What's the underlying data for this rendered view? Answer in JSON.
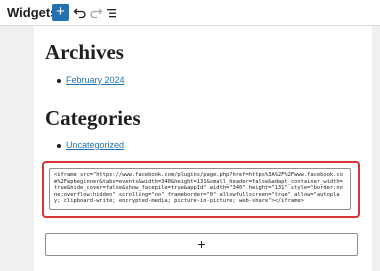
{
  "header": {
    "title": "Widgets",
    "add_label": "+"
  },
  "archives": {
    "heading": "Archives",
    "items": [
      "February 2024"
    ]
  },
  "categories": {
    "heading": "Categories",
    "items": [
      "Uncategorized"
    ]
  },
  "custom_html": {
    "code": "<iframe src=\"https://www.facebook.com/plugins/page.php?href=https%3A%2F%2Fwww.facebook.com%2Fwpbeginner&tabs=events&width=340&height=131&small_header=false&adapt_container_width=true&hide_cover=false&show_facepile=true&appId\" width=\"340\" height=\"131\" style=\"border:none;overflow:hidden\" scrolling=\"no\" frameborder=\"0\" allowfullscreen=\"true\" allow=\"autoplay; clipboard-write; encrypted-media; picture-in-picture; web-share\"></iframe>"
  },
  "inserter": {
    "label": "+"
  },
  "colors": {
    "accent": "#2271b1",
    "highlight": "#d63638"
  }
}
